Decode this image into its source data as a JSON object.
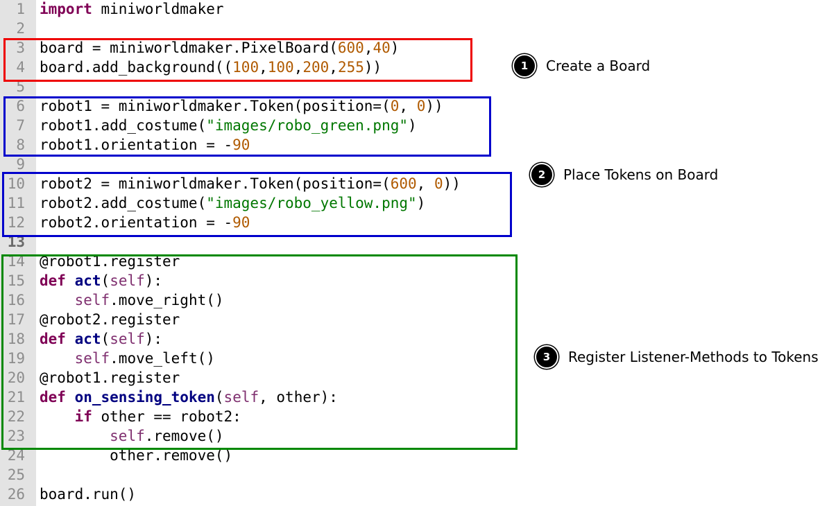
{
  "editor": {
    "lines": [
      {
        "num": "1",
        "tokens": [
          {
            "t": "import",
            "c": "kw"
          },
          {
            "t": " miniworldmaker",
            "c": "plain"
          }
        ]
      },
      {
        "num": "2",
        "tokens": []
      },
      {
        "num": "3",
        "tokens": [
          {
            "t": "board = miniworldmaker.PixelBoard(",
            "c": "plain"
          },
          {
            "t": "600",
            "c": "num"
          },
          {
            "t": ",",
            "c": "plain"
          },
          {
            "t": "40",
            "c": "num"
          },
          {
            "t": ")",
            "c": "plain"
          }
        ]
      },
      {
        "num": "4",
        "tokens": [
          {
            "t": "board.add_background((",
            "c": "plain"
          },
          {
            "t": "100",
            "c": "num"
          },
          {
            "t": ",",
            "c": "plain"
          },
          {
            "t": "100",
            "c": "num"
          },
          {
            "t": ",",
            "c": "plain"
          },
          {
            "t": "200",
            "c": "num"
          },
          {
            "t": ",",
            "c": "plain"
          },
          {
            "t": "255",
            "c": "num"
          },
          {
            "t": "))",
            "c": "plain"
          }
        ]
      },
      {
        "num": "5",
        "tokens": []
      },
      {
        "num": "6",
        "tokens": [
          {
            "t": "robot1 = miniworldmaker.Token(position=(",
            "c": "plain"
          },
          {
            "t": "0",
            "c": "num"
          },
          {
            "t": ", ",
            "c": "plain"
          },
          {
            "t": "0",
            "c": "num"
          },
          {
            "t": "))",
            "c": "plain"
          }
        ]
      },
      {
        "num": "7",
        "tokens": [
          {
            "t": "robot1.add_costume(",
            "c": "plain"
          },
          {
            "t": "\"images/robo_green.png\"",
            "c": "str"
          },
          {
            "t": ")",
            "c": "plain"
          }
        ]
      },
      {
        "num": "8",
        "tokens": [
          {
            "t": "robot1.orientation = -",
            "c": "plain"
          },
          {
            "t": "90",
            "c": "num"
          }
        ]
      },
      {
        "num": "9",
        "tokens": []
      },
      {
        "num": "10",
        "tokens": [
          {
            "t": "robot2 = miniworldmaker.Token(position=(",
            "c": "plain"
          },
          {
            "t": "600",
            "c": "num"
          },
          {
            "t": ", ",
            "c": "plain"
          },
          {
            "t": "0",
            "c": "num"
          },
          {
            "t": "))",
            "c": "plain"
          }
        ]
      },
      {
        "num": "11",
        "tokens": [
          {
            "t": "robot2.add_costume(",
            "c": "plain"
          },
          {
            "t": "\"images/robo_yellow.png\"",
            "c": "str"
          },
          {
            "t": ")",
            "c": "plain"
          }
        ]
      },
      {
        "num": "12",
        "tokens": [
          {
            "t": "robot2.orientation = -",
            "c": "plain"
          },
          {
            "t": "90",
            "c": "num"
          }
        ]
      },
      {
        "num": "13",
        "tokens": [],
        "bold": true
      },
      {
        "num": "14",
        "tokens": [
          {
            "t": "@robot1.register",
            "c": "plain"
          }
        ]
      },
      {
        "num": "15",
        "tokens": [
          {
            "t": "def",
            "c": "kw"
          },
          {
            "t": " ",
            "c": "plain"
          },
          {
            "t": "act",
            "c": "fn"
          },
          {
            "t": "(",
            "c": "plain"
          },
          {
            "t": "self",
            "c": "self"
          },
          {
            "t": "):",
            "c": "plain"
          }
        ]
      },
      {
        "num": "16",
        "tokens": [
          {
            "t": "    ",
            "c": "plain"
          },
          {
            "t": "self",
            "c": "self"
          },
          {
            "t": ".move_right()",
            "c": "plain"
          }
        ]
      },
      {
        "num": "17",
        "tokens": [
          {
            "t": "@robot2.register",
            "c": "plain"
          }
        ]
      },
      {
        "num": "18",
        "tokens": [
          {
            "t": "def",
            "c": "kw"
          },
          {
            "t": " ",
            "c": "plain"
          },
          {
            "t": "act",
            "c": "fn"
          },
          {
            "t": "(",
            "c": "plain"
          },
          {
            "t": "self",
            "c": "self"
          },
          {
            "t": "):",
            "c": "plain"
          }
        ]
      },
      {
        "num": "19",
        "tokens": [
          {
            "t": "    ",
            "c": "plain"
          },
          {
            "t": "self",
            "c": "self"
          },
          {
            "t": ".move_left()",
            "c": "plain"
          }
        ]
      },
      {
        "num": "20",
        "tokens": [
          {
            "t": "@robot1.register",
            "c": "plain"
          }
        ]
      },
      {
        "num": "21",
        "tokens": [
          {
            "t": "def",
            "c": "kw"
          },
          {
            "t": " ",
            "c": "plain"
          },
          {
            "t": "on_sensing_token",
            "c": "fn"
          },
          {
            "t": "(",
            "c": "plain"
          },
          {
            "t": "self",
            "c": "self"
          },
          {
            "t": ", other):",
            "c": "plain"
          }
        ]
      },
      {
        "num": "22",
        "tokens": [
          {
            "t": "    ",
            "c": "plain"
          },
          {
            "t": "if",
            "c": "kw"
          },
          {
            "t": " other == robot2:",
            "c": "plain"
          }
        ]
      },
      {
        "num": "23",
        "tokens": [
          {
            "t": "        ",
            "c": "plain"
          },
          {
            "t": "self",
            "c": "self"
          },
          {
            "t": ".remove()",
            "c": "plain"
          }
        ]
      },
      {
        "num": "24",
        "tokens": [
          {
            "t": "        other.remove()",
            "c": "plain"
          }
        ]
      },
      {
        "num": "25",
        "tokens": []
      },
      {
        "num": "26",
        "tokens": [
          {
            "t": "board.run()",
            "c": "plain"
          }
        ]
      }
    ]
  },
  "annotations": [
    {
      "number": "1",
      "label": "Create a Board",
      "color": "#ee0000"
    },
    {
      "number": "2",
      "label": "Place Tokens on Board",
      "color": "#0000cc"
    },
    {
      "number": "3",
      "label": "Register Listener-Methods to Tokens",
      "color": "#008800"
    }
  ],
  "colors": {
    "keyword": "#7f0055",
    "function": "#000080",
    "number": "#b05a00",
    "string": "#007700",
    "self": "#7f2f6f",
    "gutter": "#e3e3e3"
  }
}
